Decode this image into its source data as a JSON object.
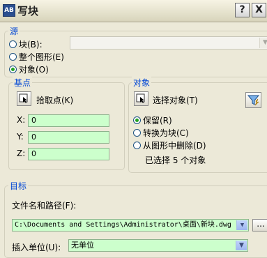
{
  "window": {
    "title": "写块",
    "app_icon_text": "AB",
    "help_label": "?",
    "close_label": "X"
  },
  "source": {
    "legend": "源",
    "block_label": "块(B):",
    "whole_drawing_label": "整个图形(E)",
    "objects_label": "对象(O)",
    "selected": "objects",
    "block_select_value": ""
  },
  "base_point": {
    "legend": "基点",
    "pick_label": "拾取点(K)",
    "x_label": "X:",
    "y_label": "Y:",
    "z_label": "Z:",
    "x_value": "0",
    "y_value": "0",
    "z_value": "0"
  },
  "objects": {
    "legend": "对象",
    "select_label": "选择对象(T)",
    "retain_label": "保留(R)",
    "convert_label": "转换为块(C)",
    "delete_label": "从图形中删除(D)",
    "selected_option": "retain",
    "status": "已选择 5 个对象"
  },
  "destination": {
    "legend": "目标",
    "path_label": "文件名和路径(F):",
    "path_value": "C:\\Documents and Settings\\Administrator\\桌面\\新块.dwg",
    "browse_label": "...",
    "units_label": "插入单位(U):",
    "units_value": "无单位"
  },
  "icons": {
    "app": "autocad-app-icon",
    "pick_point": "pick-point-icon",
    "select_objects": "select-objects-icon",
    "quick_select": "quick-select-filter-icon"
  },
  "colors": {
    "input_bg": "#ccffcc",
    "legend_text": "#0046d5",
    "dialog_bg": "#ece9d8"
  }
}
